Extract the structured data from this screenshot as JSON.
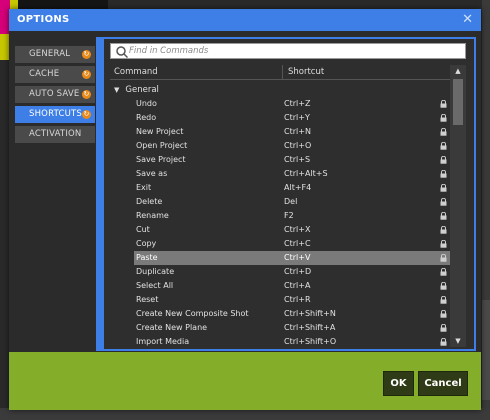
{
  "dialog": {
    "title": "OPTIONS",
    "close_icon": "close-icon"
  },
  "sidebar": {
    "items": [
      {
        "label": "GENERAL",
        "icon": "refresh-icon",
        "active": false
      },
      {
        "label": "CACHE",
        "icon": "refresh-icon",
        "active": false
      },
      {
        "label": "AUTO SAVE",
        "icon": "refresh-icon",
        "active": false
      },
      {
        "label": "SHORTCUTS",
        "icon": "refresh-icon",
        "active": true
      },
      {
        "label": "ACTIVATION",
        "icon": "",
        "active": false
      }
    ]
  },
  "search": {
    "placeholder": "Find in Commands",
    "value": ""
  },
  "table": {
    "headers": {
      "command": "Command",
      "shortcut": "Shortcut"
    },
    "group": "General",
    "rows": [
      {
        "command": "Undo",
        "shortcut": "Ctrl+Z"
      },
      {
        "command": "Redo",
        "shortcut": "Ctrl+Y"
      },
      {
        "command": "New Project",
        "shortcut": "Ctrl+N"
      },
      {
        "command": "Open Project",
        "shortcut": "Ctrl+O"
      },
      {
        "command": "Save Project",
        "shortcut": "Ctrl+S"
      },
      {
        "command": "Save as",
        "shortcut": "Ctrl+Alt+S"
      },
      {
        "command": "Exit",
        "shortcut": "Alt+F4"
      },
      {
        "command": "Delete",
        "shortcut": "Del"
      },
      {
        "command": "Rename",
        "shortcut": "F2"
      },
      {
        "command": "Cut",
        "shortcut": "Ctrl+X"
      },
      {
        "command": "Copy",
        "shortcut": "Ctrl+C"
      },
      {
        "command": "Paste",
        "shortcut": "Ctrl+V",
        "selected": true
      },
      {
        "command": "Duplicate",
        "shortcut": "Ctrl+D"
      },
      {
        "command": "Select All",
        "shortcut": "Ctrl+A"
      },
      {
        "command": "Reset",
        "shortcut": "Ctrl+R"
      },
      {
        "command": "Create New Composite Shot",
        "shortcut": "Ctrl+Shift+N"
      },
      {
        "command": "Create New Plane",
        "shortcut": "Ctrl+Shift+A"
      },
      {
        "command": "Import Media",
        "shortcut": "Ctrl+Shift+O"
      }
    ]
  },
  "buttons": {
    "ok": "OK",
    "cancel": "Cancel"
  },
  "colors": {
    "accent": "#3d7fe6",
    "footer": "#84ad2a",
    "button": "#2f3b16",
    "sidebar_dot": "#e88a1a",
    "selected_row": "#7a7a7a"
  }
}
